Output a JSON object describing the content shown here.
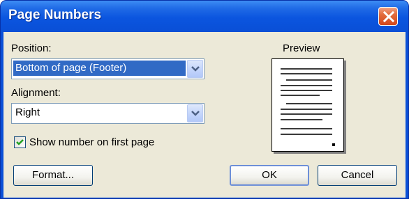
{
  "dialog": {
    "title": "Page Numbers"
  },
  "position": {
    "label": "Position:",
    "value": "Bottom of page (Footer)"
  },
  "alignment": {
    "label": "Alignment:",
    "value": "Right"
  },
  "first_page": {
    "label": "Show number on first page",
    "checked": true
  },
  "preview": {
    "label": "Preview"
  },
  "buttons": {
    "format": "Format...",
    "ok": "OK",
    "cancel": "Cancel"
  },
  "icons": {
    "close": "close-icon",
    "dropdown": "chevron-down-icon",
    "check": "checkmark-icon"
  },
  "colors": {
    "titlebar": "#0a4fd6",
    "close_button": "#d2481c",
    "dialog_background": "#ece9d8",
    "selection": "#316ac5"
  }
}
